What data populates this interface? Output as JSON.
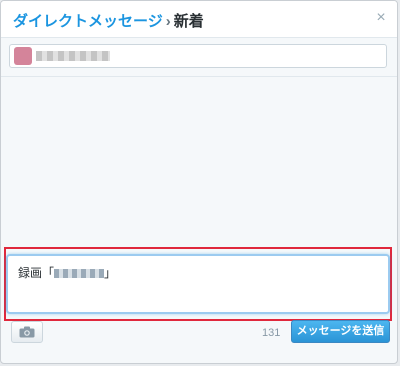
{
  "header": {
    "title_main": "ダイレクトメッセージ",
    "title_separator": "›",
    "title_sub": "新着",
    "close_label": "×"
  },
  "compose": {
    "text_prefix": "録画「",
    "text_suffix": "」"
  },
  "footer": {
    "char_count": "131",
    "send_label": "メッセージを送信"
  },
  "colors": {
    "accent": "#1b95e0",
    "highlight_frame": "#e0283c"
  }
}
